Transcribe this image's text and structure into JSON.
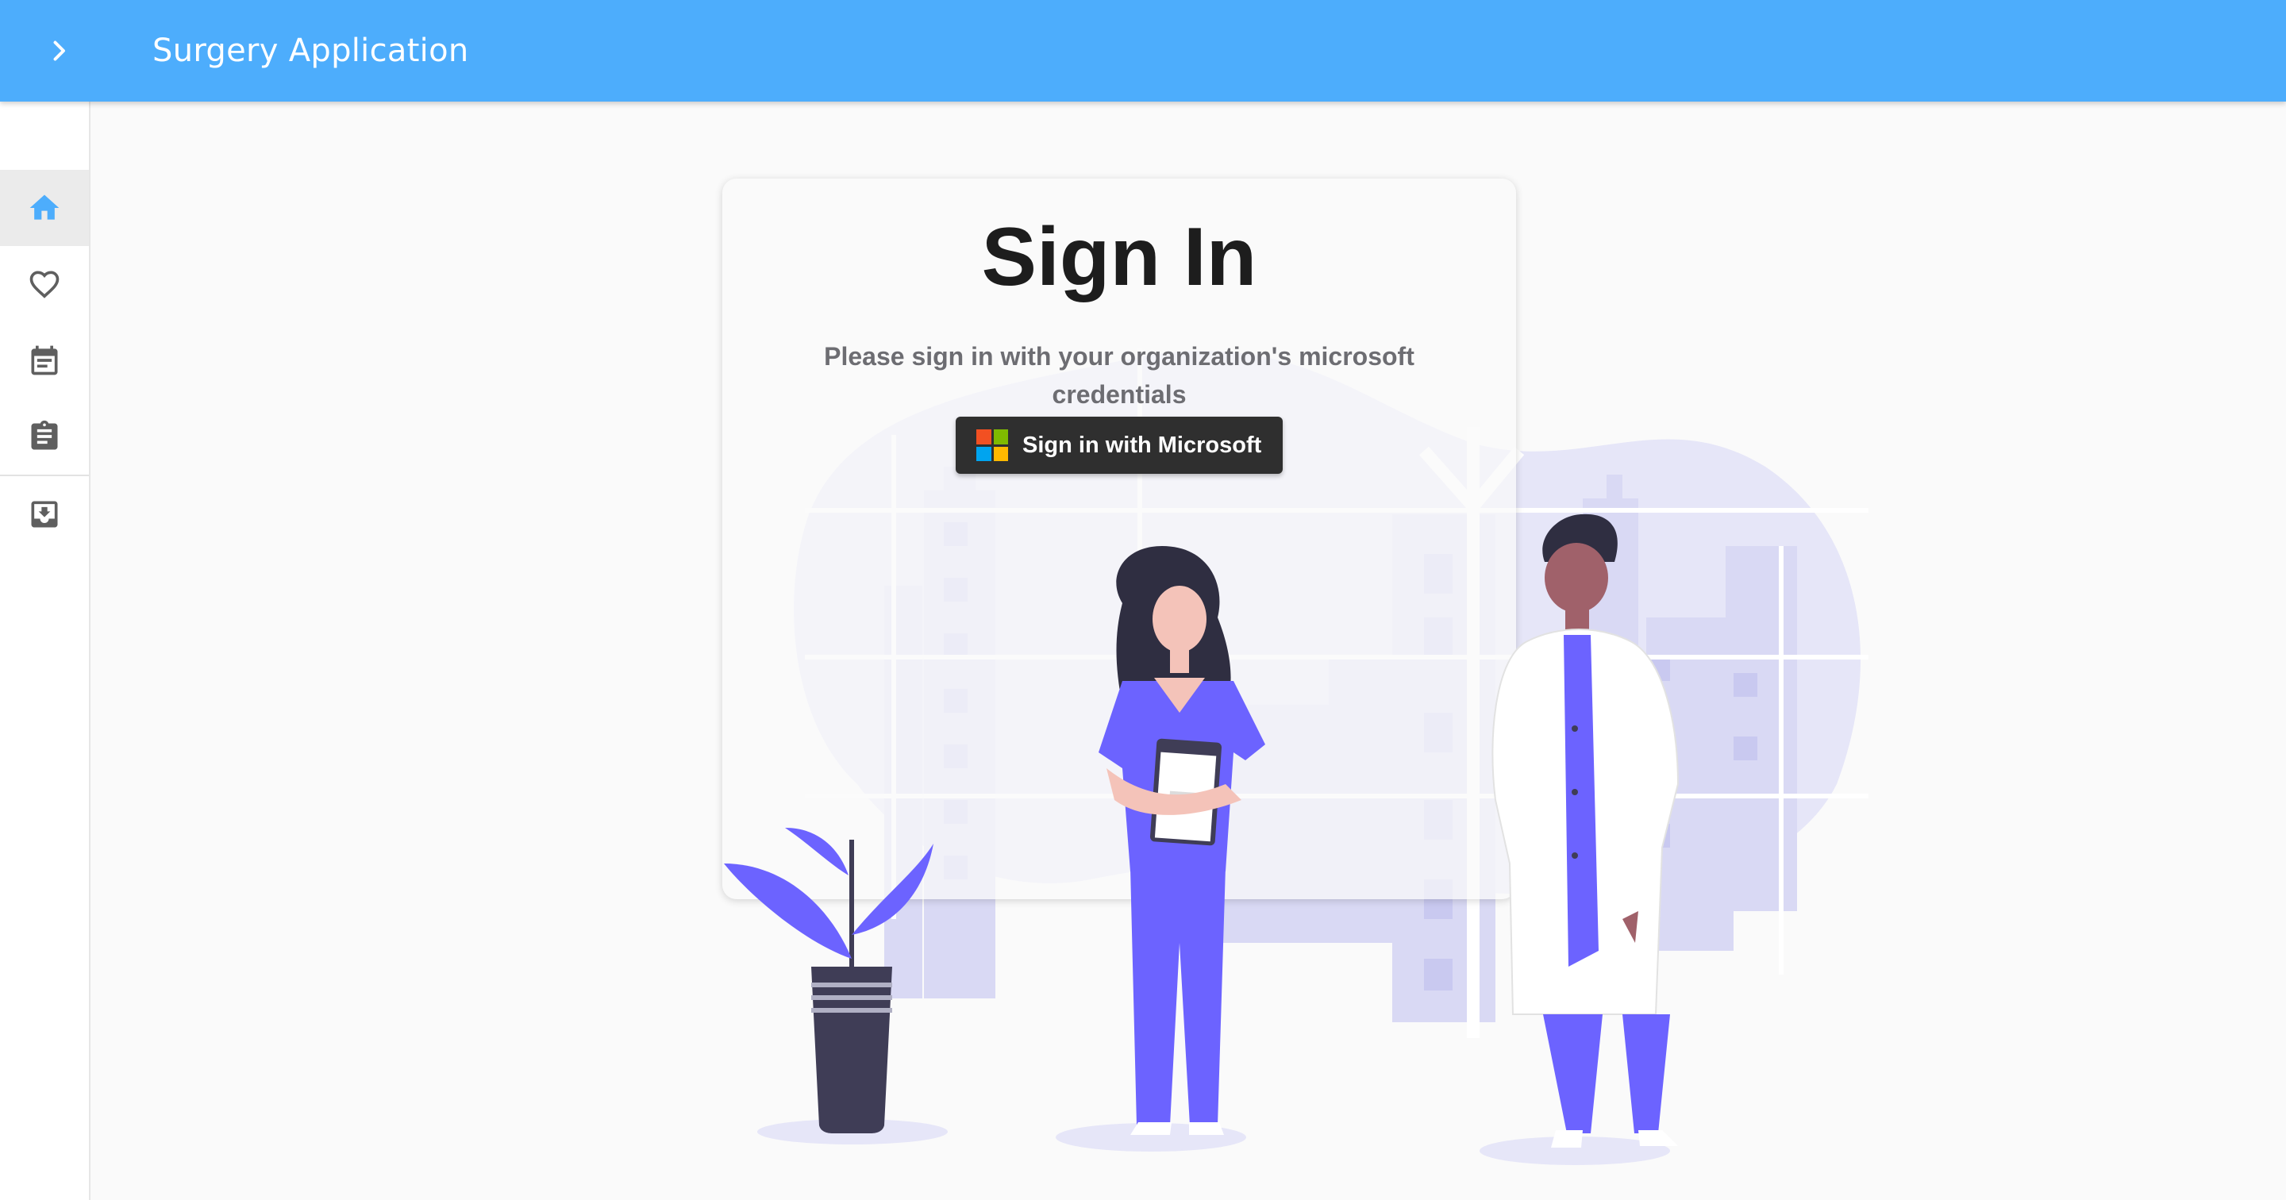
{
  "app": {
    "title": "Surgery Application"
  },
  "appbar": {
    "toggle_icon": "chevron-right-icon"
  },
  "sidebar": {
    "items": [
      {
        "icon": "home-icon",
        "active": true
      },
      {
        "icon": "heart-icon",
        "active": false
      },
      {
        "icon": "calendar-icon",
        "active": false
      },
      {
        "icon": "clipboard-icon",
        "active": false
      },
      {
        "icon": "inbox-download-icon",
        "active": false
      }
    ]
  },
  "signin": {
    "title": "Sign In",
    "subtitle": "Please sign in with your organization's microsoft credentials",
    "button_label": "Sign in with Microsoft",
    "button_icon": "microsoft-logo-icon"
  },
  "colors": {
    "appbar": "#4dadfc",
    "active_icon": "#4dadfc",
    "icon": "#5f5f5f",
    "illustration_purple": "#6c63ff",
    "illustration_bg": "#e6e6f8",
    "ms_red": "#f25022",
    "ms_green": "#7fba00",
    "ms_blue": "#00a4ef",
    "ms_yellow": "#ffb900"
  }
}
